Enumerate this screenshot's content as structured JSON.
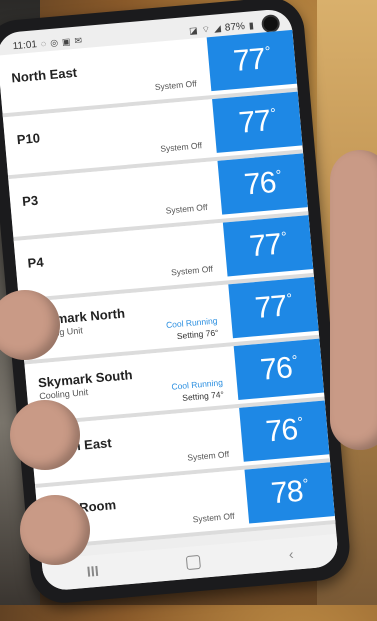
{
  "status_bar": {
    "time": "11:01",
    "battery": "87%"
  },
  "zones": [
    {
      "name": "North East",
      "sub": "",
      "status": "System Off",
      "running": false,
      "setting": "",
      "temp": "77"
    },
    {
      "name": "P10",
      "sub": "",
      "status": "System Off",
      "running": false,
      "setting": "",
      "temp": "77"
    },
    {
      "name": "P3",
      "sub": "",
      "status": "System Off",
      "running": false,
      "setting": "",
      "temp": "76"
    },
    {
      "name": "P4",
      "sub": "",
      "status": "System Off",
      "running": false,
      "setting": "",
      "temp": "77"
    },
    {
      "name": "Skymark North",
      "sub": "Cooling Unit",
      "status": "Cool Running",
      "running": true,
      "setting": "Setting 76°",
      "temp": "77"
    },
    {
      "name": "Skymark South",
      "sub": "Cooling Unit",
      "status": "Cool Running",
      "running": true,
      "setting": "Setting 74°",
      "temp": "76"
    },
    {
      "name": "South East",
      "sub": "",
      "status": "System Off",
      "running": false,
      "setting": "",
      "temp": "76"
    },
    {
      "name": "Tool Room",
      "sub": "",
      "status": "System Off",
      "running": false,
      "setting": "",
      "temp": "78"
    }
  ],
  "colors": {
    "tile": "#1e88e5",
    "running_text": "#2b8fe0"
  },
  "icons": {
    "degree": "°",
    "back": "‹"
  }
}
